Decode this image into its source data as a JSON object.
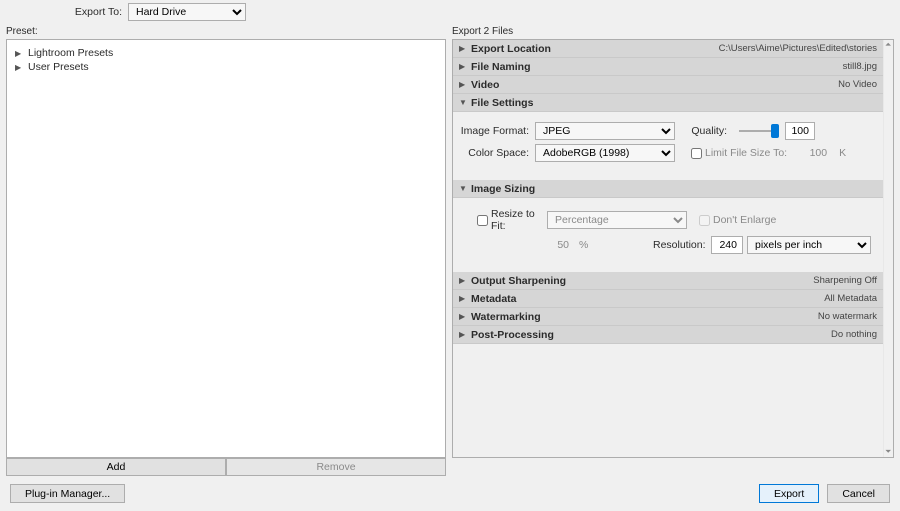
{
  "header": {
    "export_to_label": "Export To:",
    "export_to_value": "Hard Drive"
  },
  "left": {
    "preset_label": "Preset:",
    "items": [
      "Lightroom Presets",
      "User Presets"
    ],
    "add_btn": "Add",
    "remove_btn": "Remove"
  },
  "right": {
    "title": "Export 2 Files",
    "sections": {
      "export_location": {
        "title": "Export Location",
        "summary": "C:\\Users\\Aime\\Pictures\\Edited\\stories"
      },
      "file_naming": {
        "title": "File Naming",
        "summary": "still8.jpg"
      },
      "video": {
        "title": "Video",
        "summary": "No Video"
      },
      "file_settings": {
        "title": "File Settings",
        "image_format_label": "Image Format:",
        "image_format_value": "JPEG",
        "quality_label": "Quality:",
        "quality_value": "100",
        "color_space_label": "Color Space:",
        "color_space_value": "AdobeRGB (1998)",
        "limit_label": "Limit File Size To:",
        "limit_value": "100",
        "limit_unit": "K"
      },
      "image_sizing": {
        "title": "Image Sizing",
        "resize_label": "Resize to Fit:",
        "resize_mode": "Percentage",
        "dont_enlarge": "Don't Enlarge",
        "percent_value": "50",
        "percent_unit": "%",
        "resolution_label": "Resolution:",
        "resolution_value": "240",
        "resolution_unit": "pixels per inch"
      },
      "output_sharpening": {
        "title": "Output Sharpening",
        "summary": "Sharpening Off"
      },
      "metadata": {
        "title": "Metadata",
        "summary": "All Metadata"
      },
      "watermarking": {
        "title": "Watermarking",
        "summary": "No watermark"
      },
      "post_processing": {
        "title": "Post-Processing",
        "summary": "Do nothing"
      }
    }
  },
  "footer": {
    "plugin_manager": "Plug-in Manager...",
    "export": "Export",
    "cancel": "Cancel"
  }
}
